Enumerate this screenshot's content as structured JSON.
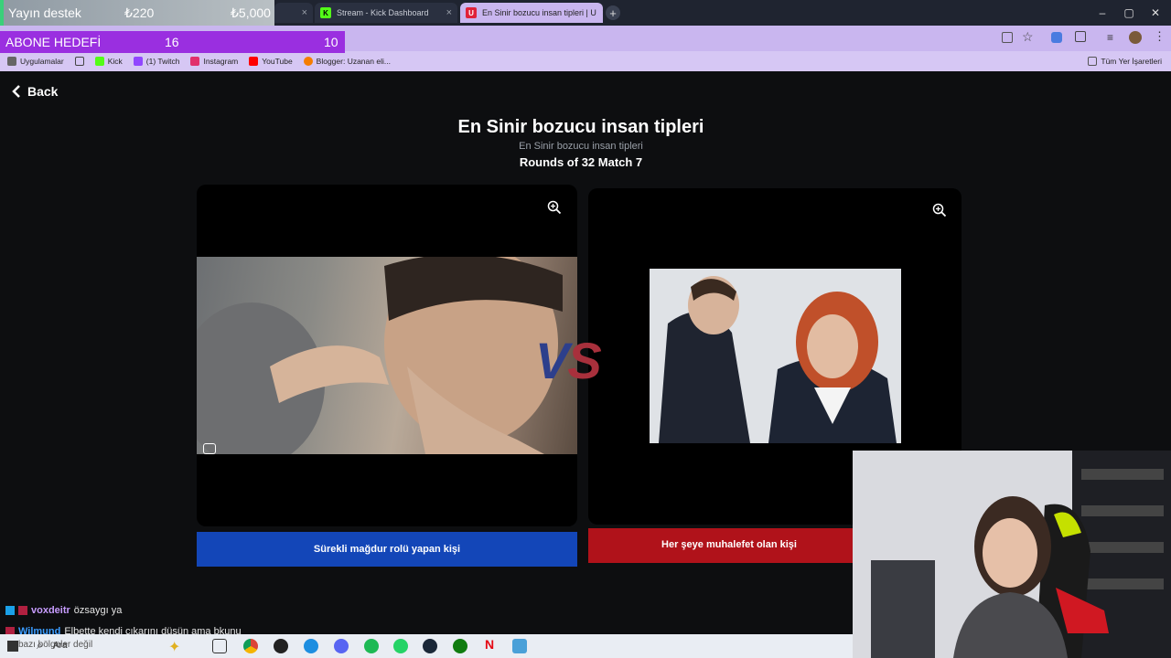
{
  "overlay": {
    "donate_label": "Yayın destek",
    "donate_current": "₺220",
    "donate_target": "₺5,000",
    "goal_label": "ABONE HEDEFİ",
    "goal_current": "16",
    "goal_remaining": "10"
  },
  "browser": {
    "tabs": [
      {
        "label": "Stream - Kick Dashboard"
      },
      {
        "label": "En Sinir bozucu insan tipleri | U"
      }
    ],
    "bookmarks": [
      "Uygulamalar",
      "Kick",
      "(1) Twitch",
      "Instagram",
      "YouTube",
      "Blogger: Uzanan eli..."
    ],
    "all_bookmarks": "Tüm Yer İşaretleri"
  },
  "page": {
    "back_label": "Back",
    "title": "En Sinir bozucu insan tipleri",
    "subtitle": "En Sinir bozucu insan tipleri",
    "round": "Rounds of 32 Match 7",
    "vs": "VS",
    "left_choice": "Sürekli mağdur rolü yapan kişi",
    "right_choice": "Her şeye muhalefet olan kişi"
  },
  "chat": [
    {
      "user": "voxdeitr",
      "message": "özsaygı ya"
    },
    {
      "user": "Wilmund",
      "message": "Elbette kendi çıkarını düşün ama bkunu"
    }
  ],
  "taskbar": {
    "search_label": "Ara",
    "weather_text": "bazı bölgeler değil"
  },
  "colors": {
    "left_button": "#1346b8",
    "right_button": "#b0121a",
    "vs_v": "#2d3f8c",
    "vs_s": "#a8303c"
  }
}
